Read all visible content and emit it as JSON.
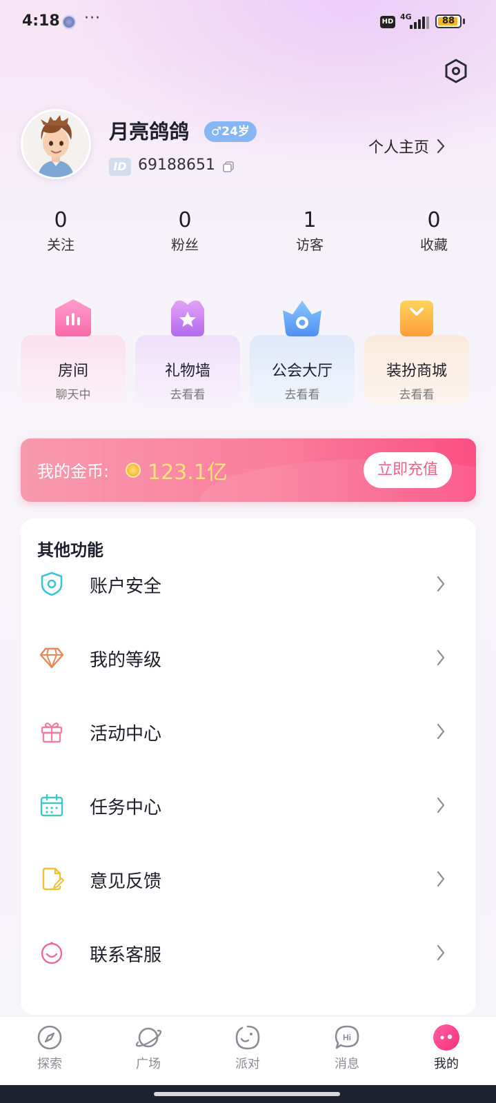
{
  "status_bar": {
    "time": "4:18",
    "more": "···",
    "hd": "HD",
    "network": "4G",
    "battery": "88"
  },
  "profile": {
    "username": "月亮鸽鸽",
    "gender_age": "♂24岁",
    "id_tag": "ID",
    "id_value": "69188651",
    "homepage_link": "个人主页"
  },
  "stats": [
    {
      "value": "0",
      "label": "关注"
    },
    {
      "value": "0",
      "label": "粉丝"
    },
    {
      "value": "1",
      "label": "访客"
    },
    {
      "value": "0",
      "label": "收藏"
    }
  ],
  "quick_cards": [
    {
      "title": "房间",
      "subtitle": "聊天中",
      "icon": "room-icon"
    },
    {
      "title": "礼物墙",
      "subtitle": "去看看",
      "icon": "gift-wall-icon"
    },
    {
      "title": "公会大厅",
      "subtitle": "去看看",
      "icon": "guild-hall-icon"
    },
    {
      "title": "装扮商城",
      "subtitle": "去看看",
      "icon": "dress-store-icon"
    }
  ],
  "coins": {
    "label": "我的金币:",
    "value": "123.1亿",
    "recharge_button": "立即充值"
  },
  "other_functions": {
    "title": "其他功能",
    "items": [
      {
        "label": "账户安全",
        "icon": "shield-icon",
        "color": "#38c5d8"
      },
      {
        "label": "我的等级",
        "icon": "diamond-icon",
        "color": "#e8875a"
      },
      {
        "label": "活动中心",
        "icon": "gift-icon",
        "color": "#ef7ea6"
      },
      {
        "label": "任务中心",
        "icon": "calendar-icon",
        "color": "#3cc8c8"
      },
      {
        "label": "意见反馈",
        "icon": "feedback-icon",
        "color": "#f0c232"
      },
      {
        "label": "联系客服",
        "icon": "service-icon",
        "color": "#ee6a92"
      }
    ]
  },
  "bottom_nav": [
    {
      "label": "探索",
      "icon": "compass-icon",
      "active": false
    },
    {
      "label": "广场",
      "icon": "planet-icon",
      "active": false
    },
    {
      "label": "派对",
      "icon": "party-icon",
      "active": false
    },
    {
      "label": "消息",
      "icon": "message-icon",
      "active": false
    },
    {
      "label": "我的",
      "icon": "me-icon",
      "active": true
    }
  ],
  "colors": {
    "accent_pink": "#fb4f84",
    "coin_gold": "#ffe27a",
    "gender_blue": "#86b6f3"
  }
}
